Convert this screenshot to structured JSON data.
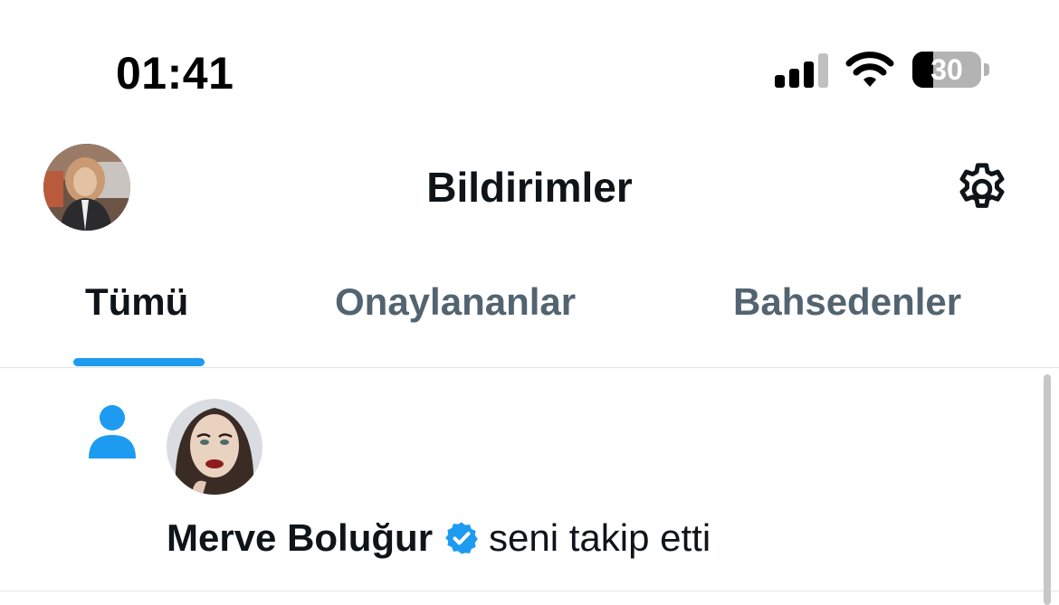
{
  "status_bar": {
    "time": "01:41",
    "battery_level": "30",
    "battery_fraction": 0.3,
    "icons": [
      "cellular-signal-icon",
      "wifi-icon",
      "battery-icon"
    ]
  },
  "header": {
    "title": "Bildirimler",
    "settings_icon": "gear-icon"
  },
  "tabs": [
    {
      "label": "Tümü",
      "active": true
    },
    {
      "label": "Onaylananlar",
      "active": false
    },
    {
      "label": "Bahsedenler",
      "active": false
    }
  ],
  "notifications": [
    {
      "type_icon": "person-icon",
      "user_name": "Merve Boluğur",
      "verified": true,
      "action": "seni takip etti"
    }
  ],
  "colors": {
    "accent": "#1d9bf0",
    "text_primary": "#0f1419",
    "text_secondary": "#536471",
    "divider": "#e1e4e7"
  }
}
